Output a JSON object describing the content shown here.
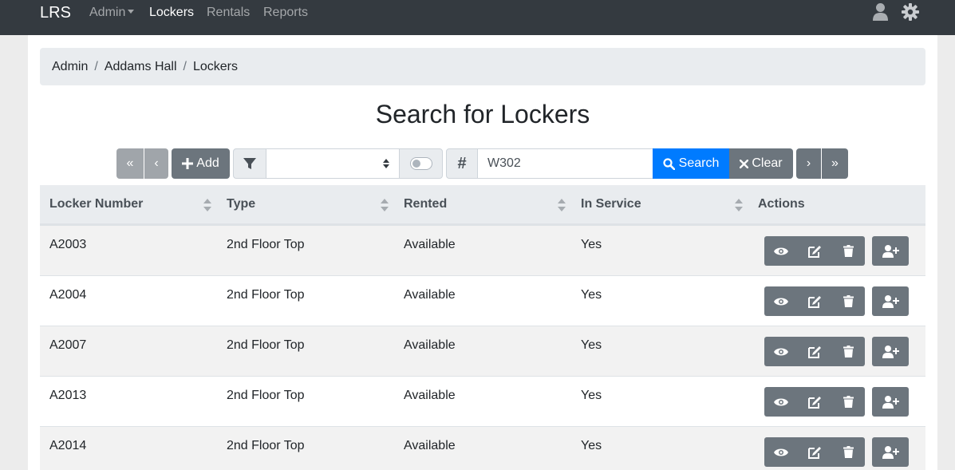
{
  "app": {
    "brand": "LRS"
  },
  "nav": {
    "admin": "Admin",
    "lockers": "Lockers",
    "rentals": "Rentals",
    "reports": "Reports"
  },
  "breadcrumb": [
    "Admin",
    "Addams Hall",
    "Lockers"
  ],
  "page_title": "Search for Lockers",
  "toolbar": {
    "first": "«",
    "prev": "‹",
    "add": "Add",
    "filter_value": "",
    "hash": "#",
    "search_value": "W302",
    "search": "Search",
    "clear": "Clear",
    "next": "›",
    "last": "»"
  },
  "table": {
    "columns": [
      "Locker Number",
      "Type",
      "Rented",
      "In Service",
      "Actions"
    ],
    "rows": [
      [
        "A2003",
        "2nd Floor Top",
        "Available",
        "Yes"
      ],
      [
        "A2004",
        "2nd Floor Top",
        "Available",
        "Yes"
      ],
      [
        "A2007",
        "2nd Floor Top",
        "Available",
        "Yes"
      ],
      [
        "A2013",
        "2nd Floor Top",
        "Available",
        "Yes"
      ],
      [
        "A2014",
        "2nd Floor Top",
        "Available",
        "Yes"
      ]
    ]
  },
  "colors": {
    "navbar": "#343a40",
    "primary": "#007bff",
    "secondary": "#6c757d"
  }
}
